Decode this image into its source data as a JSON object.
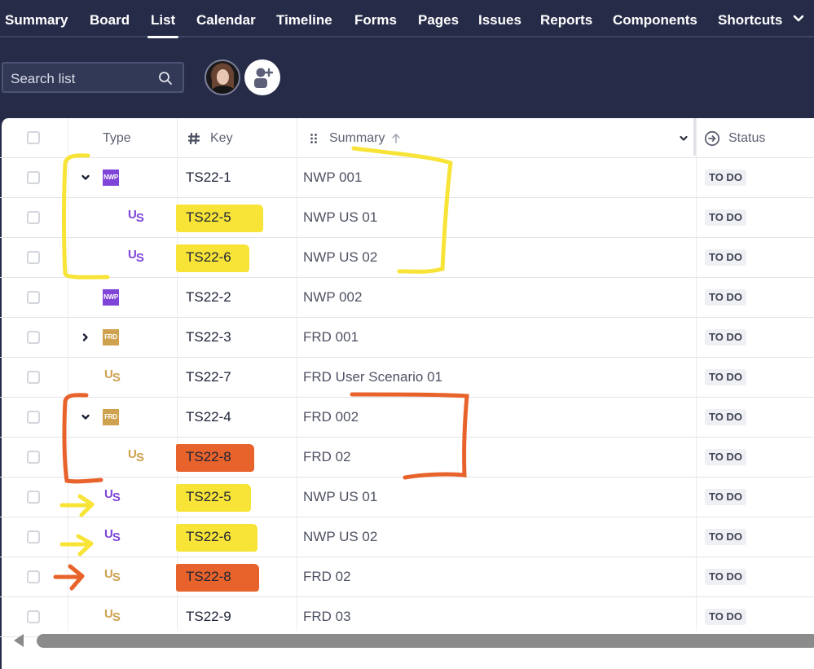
{
  "nav": {
    "tabs": [
      {
        "label": "Summary",
        "active": false
      },
      {
        "label": "Board",
        "active": false
      },
      {
        "label": "List",
        "active": true
      },
      {
        "label": "Calendar",
        "active": false
      },
      {
        "label": "Timeline",
        "active": false
      },
      {
        "label": "Forms",
        "active": false
      },
      {
        "label": "Pages",
        "active": false
      },
      {
        "label": "Issues",
        "active": false
      },
      {
        "label": "Reports",
        "active": false
      },
      {
        "label": "Components",
        "active": false
      },
      {
        "label": "Shortcuts",
        "active": false
      }
    ],
    "more_icon": "chevron-down-icon"
  },
  "toolbar": {
    "search_placeholder": "Search list",
    "search_icon": "search-icon",
    "avatar_icon": "user-avatar",
    "add_people_icon": "add-person-icon"
  },
  "table": {
    "columns": {
      "type": "Type",
      "key": "Key",
      "summary": "Summary",
      "status": "Status"
    },
    "column_icons": {
      "key": "hash-icon",
      "summary": "drag-handle-icon",
      "summary_sort": "arrow-up-icon",
      "summary_menu": "chevron-down-icon",
      "status": "arrow-right-circle-icon"
    },
    "rows": [
      {
        "type": "NWP",
        "type_kind": "badge",
        "color": "#7f45d8",
        "expand": "expanded",
        "indent": 0,
        "key": "TS22-1",
        "summary": "NWP 001",
        "status": "TO DO"
      },
      {
        "type": "US",
        "type_kind": "us",
        "color": "#7f45d8",
        "expand": "none",
        "indent": 1,
        "key": "TS22-5",
        "summary": "NWP US 01",
        "status": "TO DO",
        "highlight": "#f7e437"
      },
      {
        "type": "US",
        "type_kind": "us",
        "color": "#7f45d8",
        "expand": "none",
        "indent": 1,
        "key": "TS22-6",
        "summary": "NWP US 02",
        "status": "TO DO",
        "highlight": "#f7e437"
      },
      {
        "type": "NWP",
        "type_kind": "badge",
        "color": "#7f45d8",
        "expand": "none",
        "indent": 0,
        "key": "TS22-2",
        "summary": "NWP 002",
        "status": "TO DO"
      },
      {
        "type": "FRD",
        "type_kind": "badge",
        "color": "#cfa24f",
        "expand": "collapsed",
        "indent": 0,
        "key": "TS22-3",
        "summary": "FRD 001",
        "status": "TO DO"
      },
      {
        "type": "US",
        "type_kind": "us",
        "color": "#cfa24f",
        "expand": "none",
        "indent": 0,
        "key": "TS22-7",
        "summary": "FRD User Scenario 01",
        "status": "TO DO"
      },
      {
        "type": "FRD",
        "type_kind": "badge",
        "color": "#cfa24f",
        "expand": "expanded",
        "indent": 0,
        "key": "TS22-4",
        "summary": "FRD 002",
        "status": "TO DO"
      },
      {
        "type": "US",
        "type_kind": "us",
        "color": "#cfa24f",
        "expand": "none",
        "indent": 1,
        "key": "TS22-8",
        "summary": "FRD 02",
        "status": "TO DO",
        "highlight": "#e8632b"
      },
      {
        "type": "US",
        "type_kind": "us",
        "color": "#7f45d8",
        "expand": "none",
        "indent": 0,
        "key": "TS22-5",
        "summary": "NWP US 01",
        "status": "TO DO",
        "highlight": "#f7e437"
      },
      {
        "type": "US",
        "type_kind": "us",
        "color": "#7f45d8",
        "expand": "none",
        "indent": 0,
        "key": "TS22-6",
        "summary": "NWP US 02",
        "status": "TO DO",
        "highlight": "#f7e437"
      },
      {
        "type": "US",
        "type_kind": "us",
        "color": "#cfa24f",
        "expand": "none",
        "indent": 0,
        "key": "TS22-8",
        "summary": "FRD 02",
        "status": "TO DO",
        "highlight": "#e8632b"
      },
      {
        "type": "US",
        "type_kind": "us",
        "color": "#cfa24f",
        "expand": "none",
        "indent": 0,
        "key": "TS22-9",
        "summary": "FRD 03",
        "status": "TO DO"
      }
    ]
  },
  "annotations": {
    "yellow": "#f7e437",
    "orange": "#e8632b"
  }
}
